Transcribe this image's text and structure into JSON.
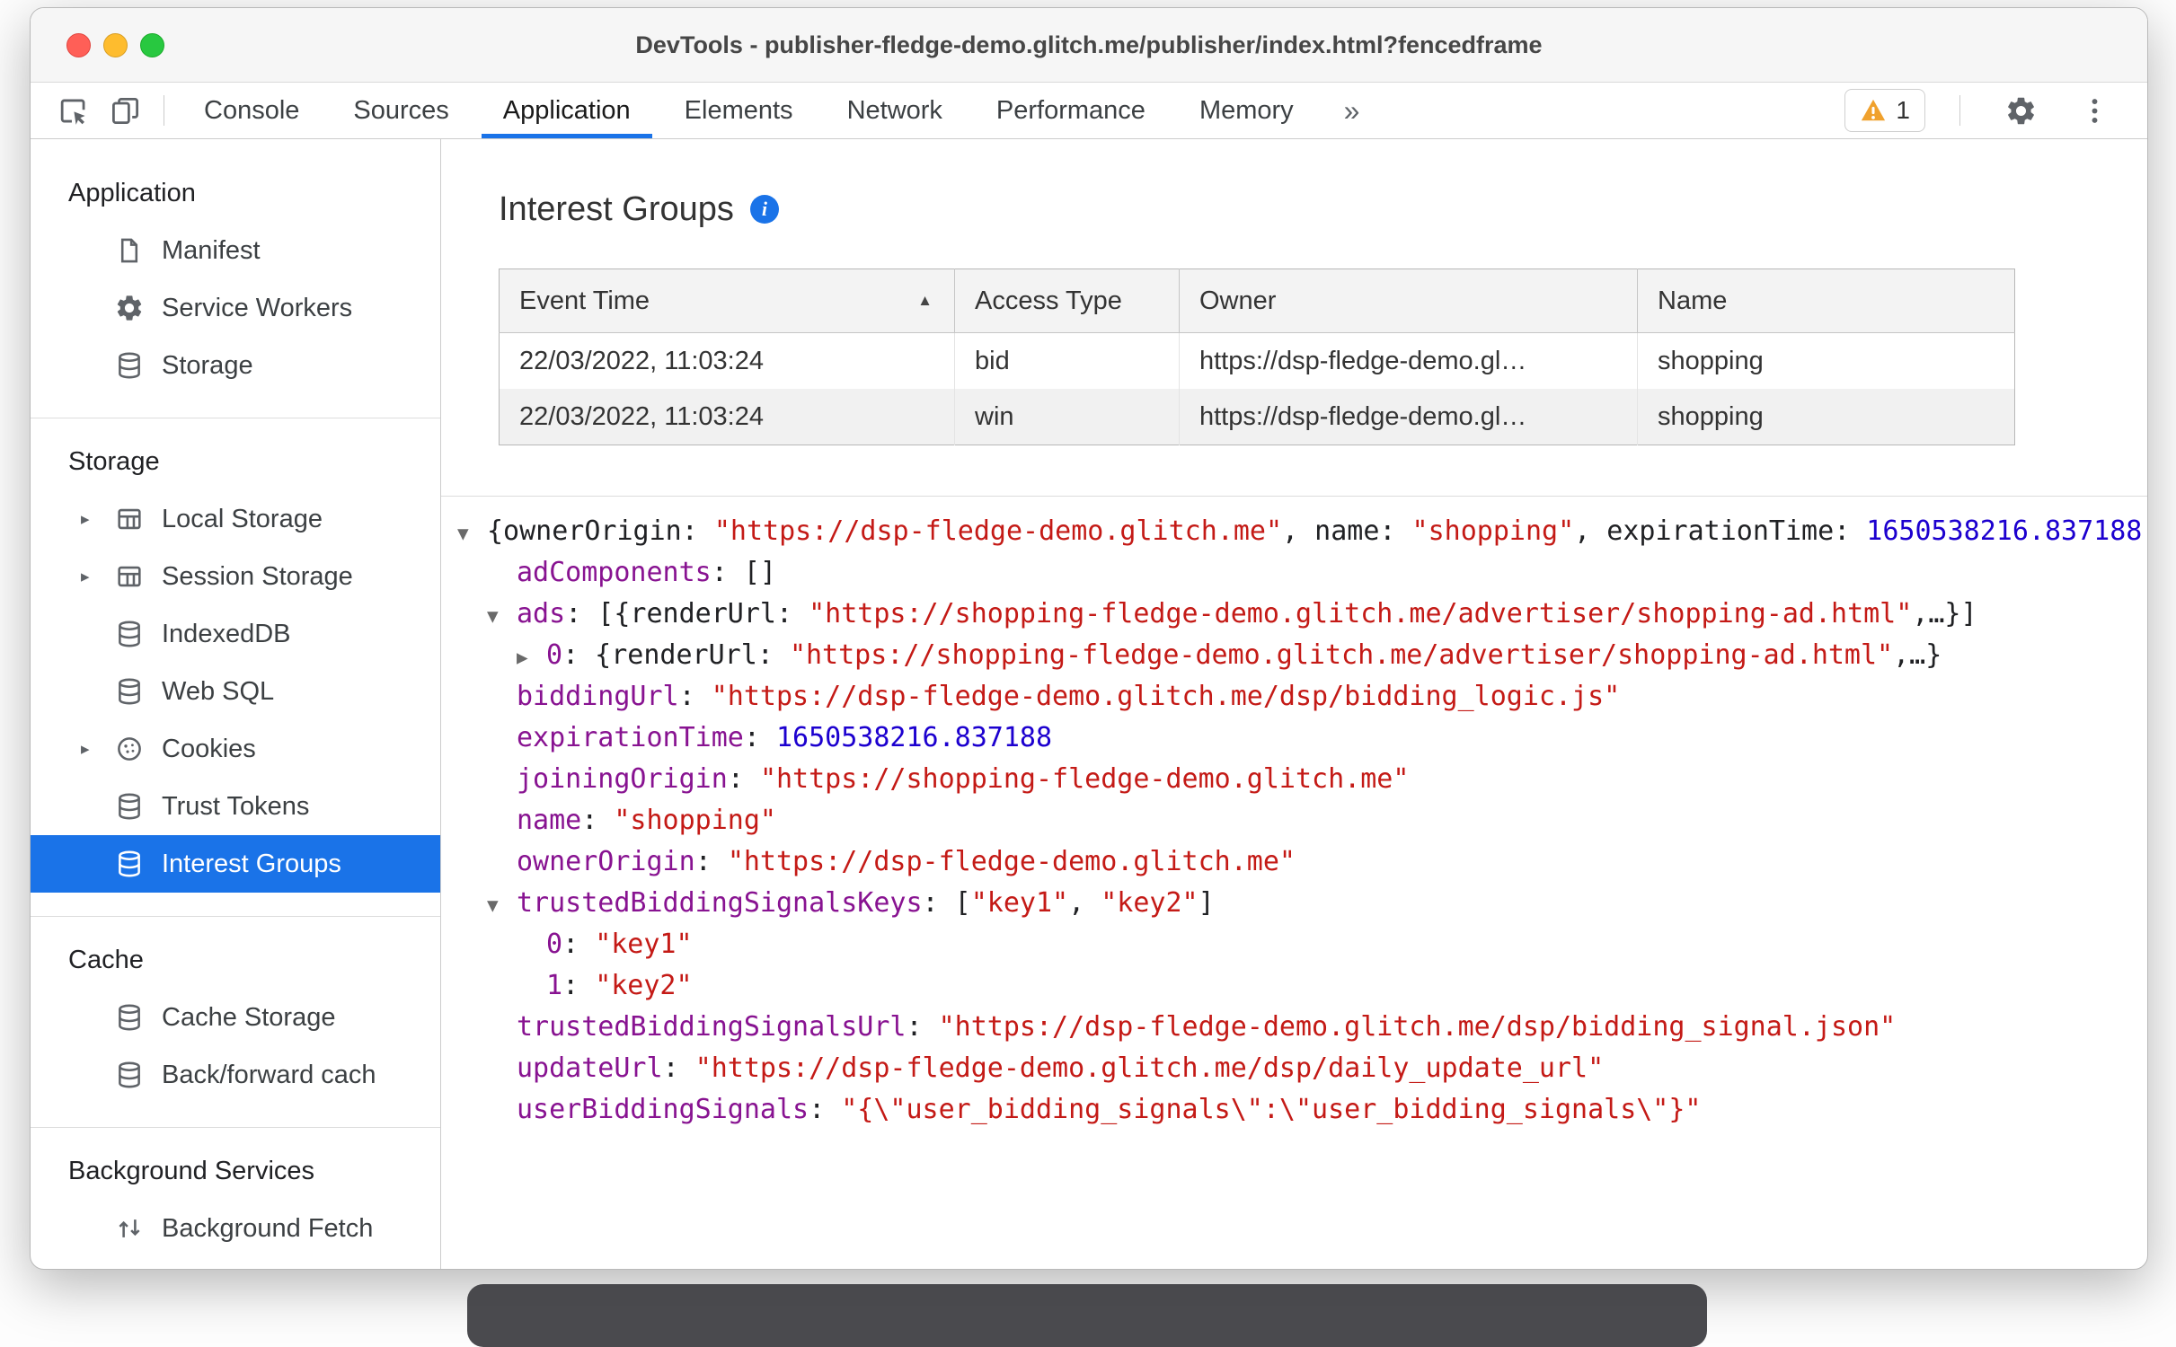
{
  "window": {
    "title": "DevTools - publisher-fledge-demo.glitch.me/publisher/index.html?fencedframe"
  },
  "toolbar": {
    "tabs": [
      {
        "label": "Console",
        "active": false
      },
      {
        "label": "Sources",
        "active": false
      },
      {
        "label": "Application",
        "active": true
      },
      {
        "label": "Elements",
        "active": false
      },
      {
        "label": "Network",
        "active": false
      },
      {
        "label": "Performance",
        "active": false
      },
      {
        "label": "Memory",
        "active": false
      }
    ],
    "more_tabs": "»",
    "warning_count": "1"
  },
  "sidebar": {
    "sections": [
      {
        "title": "Application",
        "items": [
          {
            "label": "Manifest",
            "icon": "document-icon",
            "expandable": false,
            "selected": false
          },
          {
            "label": "Service Workers",
            "icon": "gear-icon",
            "expandable": false,
            "selected": false
          },
          {
            "label": "Storage",
            "icon": "database-icon",
            "expandable": false,
            "selected": false
          }
        ]
      },
      {
        "title": "Storage",
        "items": [
          {
            "label": "Local Storage",
            "icon": "table-icon",
            "expandable": true,
            "selected": false
          },
          {
            "label": "Session Storage",
            "icon": "table-icon",
            "expandable": true,
            "selected": false
          },
          {
            "label": "IndexedDB",
            "icon": "database-icon",
            "expandable": false,
            "selected": false
          },
          {
            "label": "Web SQL",
            "icon": "database-icon",
            "expandable": false,
            "selected": false
          },
          {
            "label": "Cookies",
            "icon": "cookie-icon",
            "expandable": true,
            "selected": false
          },
          {
            "label": "Trust Tokens",
            "icon": "database-icon",
            "expandable": false,
            "selected": false
          },
          {
            "label": "Interest Groups",
            "icon": "database-icon",
            "expandable": false,
            "selected": true
          }
        ]
      },
      {
        "title": "Cache",
        "items": [
          {
            "label": "Cache Storage",
            "icon": "database-icon",
            "expandable": false,
            "selected": false
          },
          {
            "label": "Back/forward cach",
            "icon": "database-icon",
            "expandable": false,
            "selected": false
          }
        ]
      },
      {
        "title": "Background Services",
        "items": [
          {
            "label": "Background Fetch",
            "icon": "fetch-icon",
            "expandable": false,
            "selected": false
          }
        ]
      }
    ]
  },
  "main": {
    "title": "Interest Groups",
    "info_glyph": "i",
    "table": {
      "columns": [
        "Event Time",
        "Access Type",
        "Owner",
        "Name"
      ],
      "sort_indicator": "▲",
      "rows": [
        [
          "22/03/2022, 11:03:24",
          "bid",
          "https://dsp-fledge-demo.gl…",
          "shopping"
        ],
        [
          "22/03/2022, 11:03:24",
          "win",
          "https://dsp-fledge-demo.gl…",
          "shopping"
        ]
      ]
    },
    "tree": {
      "lines": [
        {
          "indent": 0,
          "arrow": "down",
          "segments": [
            {
              "c": "p",
              "t": "{ownerOrigin: "
            },
            {
              "c": "s",
              "t": "\"https://dsp-fledge-demo.glitch.me\""
            },
            {
              "c": "p",
              "t": ", name: "
            },
            {
              "c": "s",
              "t": "\"shopping\""
            },
            {
              "c": "p",
              "t": ", expirationTime: "
            },
            {
              "c": "n",
              "t": "1650538216.837188"
            }
          ]
        },
        {
          "indent": 1,
          "arrow": null,
          "segments": [
            {
              "c": "k",
              "t": "adComponents"
            },
            {
              "c": "p",
              "t": ": []"
            }
          ]
        },
        {
          "indent": 1,
          "arrow": "down",
          "segments": [
            {
              "c": "k",
              "t": "ads"
            },
            {
              "c": "p",
              "t": ": [{renderUrl: "
            },
            {
              "c": "s",
              "t": "\"https://shopping-fledge-demo.glitch.me/advertiser/shopping-ad.html\""
            },
            {
              "c": "p",
              "t": ",…}]"
            }
          ]
        },
        {
          "indent": 2,
          "arrow": "right",
          "segments": [
            {
              "c": "k",
              "t": "0"
            },
            {
              "c": "p",
              "t": ": {renderUrl: "
            },
            {
              "c": "s",
              "t": "\"https://shopping-fledge-demo.glitch.me/advertiser/shopping-ad.html\""
            },
            {
              "c": "p",
              "t": ",…}"
            }
          ]
        },
        {
          "indent": 1,
          "arrow": null,
          "segments": [
            {
              "c": "k",
              "t": "biddingUrl"
            },
            {
              "c": "p",
              "t": ": "
            },
            {
              "c": "s",
              "t": "\"https://dsp-fledge-demo.glitch.me/dsp/bidding_logic.js\""
            }
          ]
        },
        {
          "indent": 1,
          "arrow": null,
          "segments": [
            {
              "c": "k",
              "t": "expirationTime"
            },
            {
              "c": "p",
              "t": ": "
            },
            {
              "c": "n",
              "t": "1650538216.837188"
            }
          ]
        },
        {
          "indent": 1,
          "arrow": null,
          "segments": [
            {
              "c": "k",
              "t": "joiningOrigin"
            },
            {
              "c": "p",
              "t": ": "
            },
            {
              "c": "s",
              "t": "\"https://shopping-fledge-demo.glitch.me\""
            }
          ]
        },
        {
          "indent": 1,
          "arrow": null,
          "segments": [
            {
              "c": "k",
              "t": "name"
            },
            {
              "c": "p",
              "t": ": "
            },
            {
              "c": "s",
              "t": "\"shopping\""
            }
          ]
        },
        {
          "indent": 1,
          "arrow": null,
          "segments": [
            {
              "c": "k",
              "t": "ownerOrigin"
            },
            {
              "c": "p",
              "t": ": "
            },
            {
              "c": "s",
              "t": "\"https://dsp-fledge-demo.glitch.me\""
            }
          ]
        },
        {
          "indent": 1,
          "arrow": "down",
          "segments": [
            {
              "c": "k",
              "t": "trustedBiddingSignalsKeys"
            },
            {
              "c": "p",
              "t": ": ["
            },
            {
              "c": "s",
              "t": "\"key1\""
            },
            {
              "c": "p",
              "t": ", "
            },
            {
              "c": "s",
              "t": "\"key2\""
            },
            {
              "c": "p",
              "t": "]"
            }
          ]
        },
        {
          "indent": 2,
          "arrow": null,
          "segments": [
            {
              "c": "k",
              "t": "0"
            },
            {
              "c": "p",
              "t": ": "
            },
            {
              "c": "s",
              "t": "\"key1\""
            }
          ]
        },
        {
          "indent": 2,
          "arrow": null,
          "segments": [
            {
              "c": "k",
              "t": "1"
            },
            {
              "c": "p",
              "t": ": "
            },
            {
              "c": "s",
              "t": "\"key2\""
            }
          ]
        },
        {
          "indent": 1,
          "arrow": null,
          "segments": [
            {
              "c": "k",
              "t": "trustedBiddingSignalsUrl"
            },
            {
              "c": "p",
              "t": ": "
            },
            {
              "c": "s",
              "t": "\"https://dsp-fledge-demo.glitch.me/dsp/bidding_signal.json\""
            }
          ]
        },
        {
          "indent": 1,
          "arrow": null,
          "segments": [
            {
              "c": "k",
              "t": "updateUrl"
            },
            {
              "c": "p",
              "t": ": "
            },
            {
              "c": "s",
              "t": "\"https://dsp-fledge-demo.glitch.me/dsp/daily_update_url\""
            }
          ]
        },
        {
          "indent": 1,
          "arrow": null,
          "segments": [
            {
              "c": "k",
              "t": "userBiddingSignals"
            },
            {
              "c": "p",
              "t": ": "
            },
            {
              "c": "s",
              "t": "\"{\\\"user_bidding_signals\\\":\\\"user_bidding_signals\\\"}\""
            }
          ]
        }
      ]
    }
  },
  "colors": {
    "accent_blue": "#1a73e8",
    "selected_item_bg": "#1a73e8",
    "tree_key_purple": "#881391",
    "tree_string_red": "#c41a16",
    "tree_number_blue": "#1c00cf",
    "warning_amber": "#f0a12d"
  }
}
